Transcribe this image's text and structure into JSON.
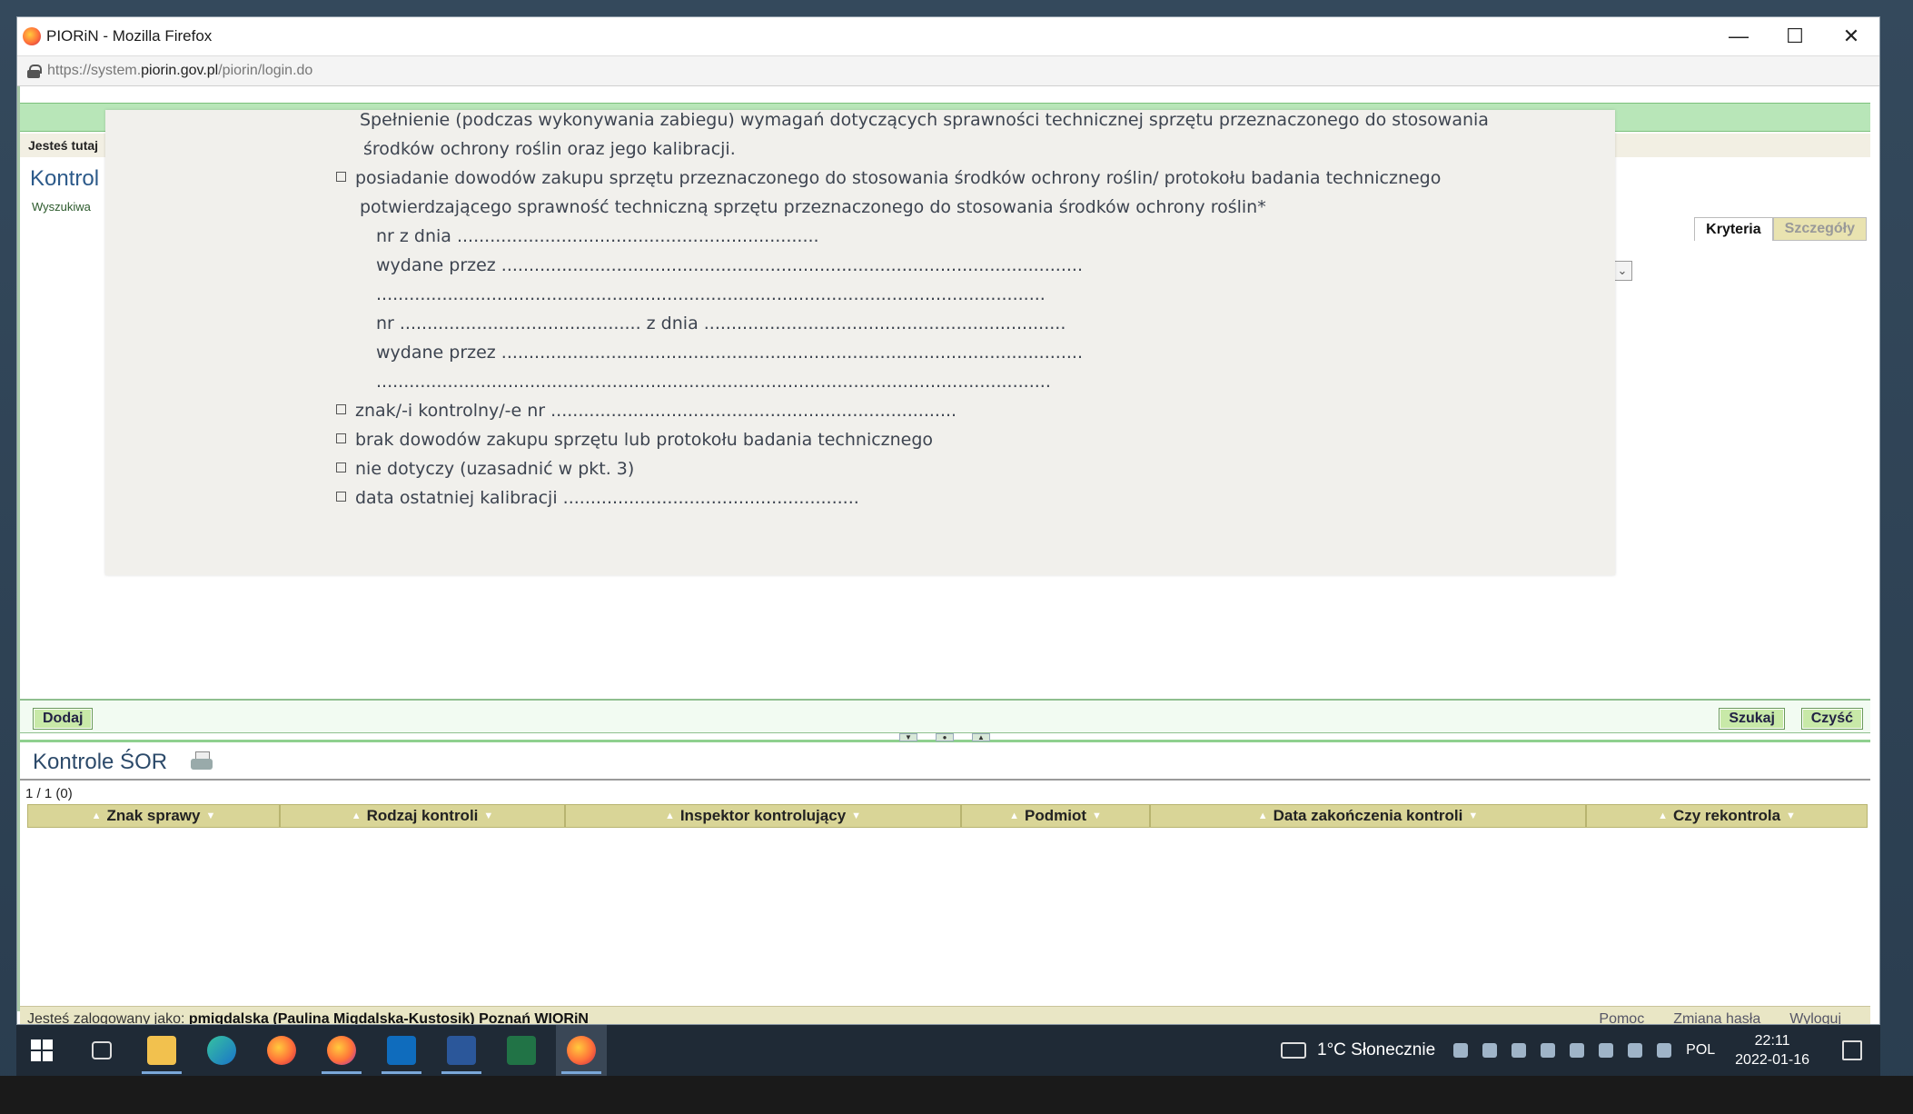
{
  "window": {
    "title": "PIORiN - Mozilla Firefox"
  },
  "address": {
    "prefix": "https://system.",
    "host": "piorin.gov.pl",
    "path": "/piorin/login.do"
  },
  "breadcrumb": "Jesteś tutaj",
  "page": {
    "heading": "Kontrol",
    "subheading": "Wyszukiwa"
  },
  "tabs": [
    {
      "label": "Kryteria"
    },
    {
      "label": "Szczegóły"
    }
  ],
  "modal": {
    "line1": "Spełnienie (podczas wykonywania zabiegu) wymagań dotyczących sprawności  technicznej sprzętu przeznaczonego do stosowania",
    "line2": "środków ochrony roślin oraz jego kalibracji.",
    "opt1a": "posiadanie dowodów zakupu sprzętu przeznaczonego do stosowania środków ochrony  roślin/ protokołu badania technicznego",
    "opt1b": "potwierdzającego sprawność techniczną sprzętu przeznaczonego do stosowania środków ochrony roślin*",
    "nr1": "nr                         z dnia ..................................................................",
    "wyd1": "wydane przez ..........................................................................................................",
    "dots1": "..........................................................................................................................",
    "nr2": "nr ............................................ z dnia ..................................................................",
    "wyd2": "wydane przez ..........................................................................................................",
    "dots2": "...........................................................................................................................",
    "opt2": "znak/-i kontrolny/-e nr ..........................................................................",
    "opt3": "brak dowodów zakupu sprzętu lub protokołu badania technicznego",
    "opt4": "nie dotyczy (uzasadnić w pkt. 3)",
    "opt5": "data ostatniej kalibracji ......................................................"
  },
  "actions": {
    "add": "Dodaj",
    "search": "Szukaj",
    "clear": "Czyść"
  },
  "list": {
    "title": "Kontrole ŚOR",
    "pager": "1 / 1 (0)",
    "columns": [
      "Znak sprawy",
      "Rodzaj kontroli",
      "Inspektor kontrolujący",
      "Podmiot",
      "Data zakończenia kontroli",
      "Czy rekontrola"
    ]
  },
  "status": {
    "prefix": "Jesteś zalogowany jako:",
    "user": "pmigdalska (Paulina Migdalska-Kustosik) Poznań WIORiN",
    "links": [
      "Pomoc",
      "Zmiana hasła",
      "Wyloguj"
    ]
  },
  "taskbar": {
    "weather": "1°C  Słonecznie",
    "lang": "POL",
    "time": "22:11",
    "date": "2022-01-16"
  },
  "colors": {
    "accent_green": "#b8e6b8",
    "button": "#c8e9a8",
    "table_header": "#d9d597",
    "status": "#e9e6c5"
  }
}
